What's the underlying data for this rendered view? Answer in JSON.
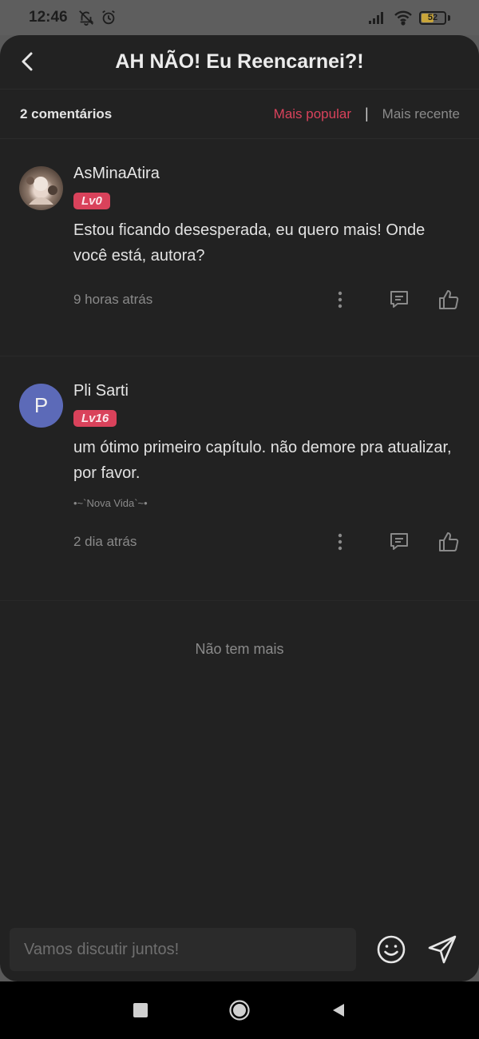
{
  "status_bar": {
    "time": "12:46",
    "battery": "52",
    "battery_level": 0.52
  },
  "header": {
    "title": "AH NÃO! Eu Reencarnei?!"
  },
  "sort_bar": {
    "count_label": "2 comentários",
    "popular_label": "Mais popular",
    "separator": "|",
    "recent_label": "Mais recente",
    "active_sort": "popular"
  },
  "comments": [
    {
      "username": "AsMinaAtira",
      "level": "Lv0",
      "text": "Estou ficando desesperada, eu quero mais! Onde você está, autora?",
      "time": "9 horas atrás"
    },
    {
      "username": "Pli Sarti",
      "avatar_letter": "P",
      "level": "Lv16",
      "text": "um ótimo primeiro capítulo.  não demore pra atualizar, por favor.",
      "signature": "•~`Nova Vida`~•",
      "time": "2 dia atrás"
    }
  ],
  "no_more_label": "Não tem mais",
  "input": {
    "placeholder": "Vamos discutir juntos!",
    "value": ""
  },
  "colors": {
    "accent": "#d9425b",
    "background": "#222222",
    "avatar_p": "#5c6ab8"
  }
}
